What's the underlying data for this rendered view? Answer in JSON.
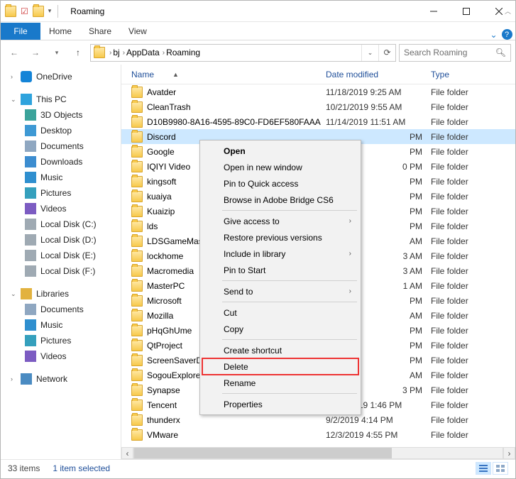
{
  "window": {
    "title": "Roaming"
  },
  "qat": {
    "icons": [
      "folder-icon",
      "properties-icon",
      "new-folder-icon",
      "chevron-down-icon"
    ]
  },
  "ribbon": {
    "file": "File",
    "tabs": [
      "Home",
      "Share",
      "View"
    ]
  },
  "breadcrumbs": [
    "bj",
    "AppData",
    "Roaming"
  ],
  "search": {
    "placeholder": "Search Roaming"
  },
  "nav": {
    "onedrive": "OneDrive",
    "thispc": "This PC",
    "pc_children": [
      "3D Objects",
      "Desktop",
      "Documents",
      "Downloads",
      "Music",
      "Pictures",
      "Videos",
      "Local Disk (C:)",
      "Local Disk (D:)",
      "Local Disk  (E:)",
      "Local Disk (F:)"
    ],
    "libraries": "Libraries",
    "lib_children": [
      "Documents",
      "Music",
      "Pictures",
      "Videos"
    ],
    "network": "Network"
  },
  "columns": {
    "name": "Name",
    "date": "Date modified",
    "type": "Type"
  },
  "type_folder": "File folder",
  "rows": [
    {
      "n": "Avatder",
      "d": "11/18/2019 9:25 AM"
    },
    {
      "n": "CleanTrash",
      "d": "10/21/2019 9:55 AM"
    },
    {
      "n": "D10B9980-8A16-4595-89C0-FD6EF580FAAA",
      "d": "11/14/2019 11:51 AM"
    },
    {
      "n": "Discord",
      "d": "PM",
      "sel": true
    },
    {
      "n": "Google",
      "d": "PM"
    },
    {
      "n": "IQIYI Video",
      "d": "0 PM"
    },
    {
      "n": "kingsoft",
      "d": "PM"
    },
    {
      "n": "kuaiya",
      "d": "PM"
    },
    {
      "n": "Kuaizip",
      "d": "PM"
    },
    {
      "n": "lds",
      "d": "PM"
    },
    {
      "n": "LDSGameMaster",
      "d": "AM"
    },
    {
      "n": "lockhome",
      "d": "3 AM"
    },
    {
      "n": "Macromedia",
      "d": "3 AM"
    },
    {
      "n": "MasterPC",
      "d": "1 AM"
    },
    {
      "n": "Microsoft",
      "d": "PM"
    },
    {
      "n": "Mozilla",
      "d": "AM"
    },
    {
      "n": "pHqGhUme",
      "d": "PM"
    },
    {
      "n": "QtProject",
      "d": "PM"
    },
    {
      "n": "ScreenSaverData",
      "d": "PM"
    },
    {
      "n": "SogouExplorer",
      "d": "AM"
    },
    {
      "n": "Synapse",
      "d": "3 PM"
    },
    {
      "n": "Tencent",
      "d": "11/14/2019 1:46 PM"
    },
    {
      "n": "thunderx",
      "d": "9/2/2019 4:14 PM"
    },
    {
      "n": "VMware",
      "d": "12/3/2019 4:55 PM"
    }
  ],
  "context_menu": {
    "open": "Open",
    "open_new": "Open in new window",
    "pin_qa": "Pin to Quick access",
    "browse_bridge": "Browse in Adobe Bridge CS6",
    "give_access": "Give access to",
    "restore": "Restore previous versions",
    "include_lib": "Include in library",
    "pin_start": "Pin to Start",
    "send_to": "Send to",
    "cut": "Cut",
    "copy": "Copy",
    "shortcut": "Create shortcut",
    "delete": "Delete",
    "rename": "Rename",
    "properties": "Properties"
  },
  "status": {
    "count": "33 items",
    "selected": "1 item selected"
  }
}
